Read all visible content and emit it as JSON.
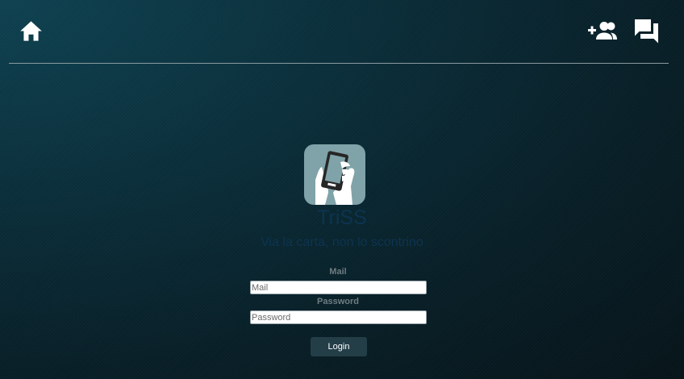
{
  "header": {
    "home_icon": "home-icon",
    "add_user_icon": "person-add-icon",
    "support_icon": "question-answer-icon"
  },
  "app": {
    "name": "TriSS",
    "tagline": "Via la carta, non lo scontrino",
    "logo_icon": "hand-holding-phone-icon"
  },
  "login_form": {
    "mail_label": "Mail",
    "mail_placeholder": "Mail",
    "mail_value": "",
    "password_label": "Password",
    "password_placeholder": "Password",
    "password_value": "",
    "login_label": "Login"
  },
  "colors": {
    "background": "#0a2f3b",
    "logo_tile": "#7fa3a8",
    "title_text": "#0d3450",
    "button": "#243e48"
  }
}
